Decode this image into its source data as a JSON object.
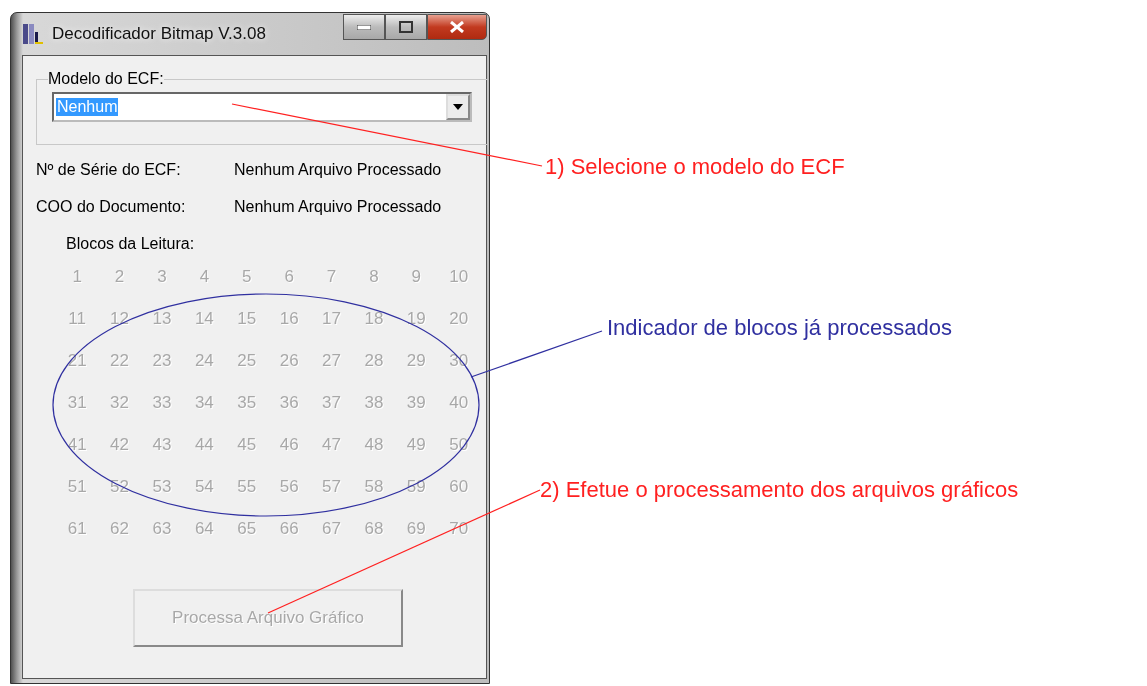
{
  "window": {
    "title": "Decodificador Bitmap V.3.08"
  },
  "model_group": {
    "label": "Modelo do ECF:",
    "combo": {
      "value": "Nenhum",
      "text_selected": true
    }
  },
  "info_rows": [
    {
      "label": "Nº de Série do ECF:",
      "value": "Nenhum Arquivo Processado"
    },
    {
      "label": "COO do Documento:",
      "value": "Nenhum Arquivo Processado"
    }
  ],
  "blocks": {
    "label": "Blocos da Leitura:",
    "items": [
      {
        "label": "1",
        "processed": false
      },
      {
        "label": "2",
        "processed": false
      },
      {
        "label": "3",
        "processed": false
      },
      {
        "label": "4",
        "processed": false
      },
      {
        "label": "5",
        "processed": false
      },
      {
        "label": "6",
        "processed": false
      },
      {
        "label": "7",
        "processed": false
      },
      {
        "label": "8",
        "processed": false
      },
      {
        "label": "9",
        "processed": false
      },
      {
        "label": "10",
        "processed": false
      },
      {
        "label": "11",
        "processed": false
      },
      {
        "label": "12",
        "processed": false
      },
      {
        "label": "13",
        "processed": false
      },
      {
        "label": "14",
        "processed": false
      },
      {
        "label": "15",
        "processed": false
      },
      {
        "label": "16",
        "processed": false
      },
      {
        "label": "17",
        "processed": false
      },
      {
        "label": "18",
        "processed": false
      },
      {
        "label": "19",
        "processed": false
      },
      {
        "label": "20",
        "processed": false
      },
      {
        "label": "21",
        "processed": false
      },
      {
        "label": "22",
        "processed": false
      },
      {
        "label": "23",
        "processed": false
      },
      {
        "label": "24",
        "processed": false
      },
      {
        "label": "25",
        "processed": false
      },
      {
        "label": "26",
        "processed": false
      },
      {
        "label": "27",
        "processed": false
      },
      {
        "label": "28",
        "processed": false
      },
      {
        "label": "29",
        "processed": false
      },
      {
        "label": "30",
        "processed": false
      },
      {
        "label": "31",
        "processed": false
      },
      {
        "label": "32",
        "processed": false
      },
      {
        "label": "33",
        "processed": false
      },
      {
        "label": "34",
        "processed": false
      },
      {
        "label": "35",
        "processed": false
      },
      {
        "label": "36",
        "processed": false
      },
      {
        "label": "37",
        "processed": false
      },
      {
        "label": "38",
        "processed": false
      },
      {
        "label": "39",
        "processed": false
      },
      {
        "label": "40",
        "processed": false
      },
      {
        "label": "41",
        "processed": false
      },
      {
        "label": "42",
        "processed": false
      },
      {
        "label": "43",
        "processed": false
      },
      {
        "label": "44",
        "processed": false
      },
      {
        "label": "45",
        "processed": false
      },
      {
        "label": "46",
        "processed": false
      },
      {
        "label": "47",
        "processed": false
      },
      {
        "label": "48",
        "processed": false
      },
      {
        "label": "49",
        "processed": false
      },
      {
        "label": "50",
        "processed": false
      },
      {
        "label": "51",
        "processed": false
      },
      {
        "label": "52",
        "processed": false
      },
      {
        "label": "53",
        "processed": false
      },
      {
        "label": "54",
        "processed": false
      },
      {
        "label": "55",
        "processed": false
      },
      {
        "label": "56",
        "processed": false
      },
      {
        "label": "57",
        "processed": false
      },
      {
        "label": "58",
        "processed": false
      },
      {
        "label": "59",
        "processed": false
      },
      {
        "label": "60",
        "processed": false
      },
      {
        "label": "61",
        "processed": false
      },
      {
        "label": "62",
        "processed": false
      },
      {
        "label": "63",
        "processed": false
      },
      {
        "label": "64",
        "processed": false
      },
      {
        "label": "65",
        "processed": false
      },
      {
        "label": "66",
        "processed": false
      },
      {
        "label": "67",
        "processed": false
      },
      {
        "label": "68",
        "processed": false
      },
      {
        "label": "69",
        "processed": false
      },
      {
        "label": "70",
        "processed": false
      }
    ]
  },
  "process_button": {
    "label": "Processa Arquivo Gráfico",
    "disabled": true
  },
  "annotations": [
    {
      "text": "1) Selecione o modelo do ECF",
      "color": "#ff2020"
    },
    {
      "text": "Indicador de blocos já processados",
      "color": "#3030a0"
    },
    {
      "text": "2) Efetue o processamento dos arquivos gráficos",
      "color": "#ff2020"
    }
  ]
}
